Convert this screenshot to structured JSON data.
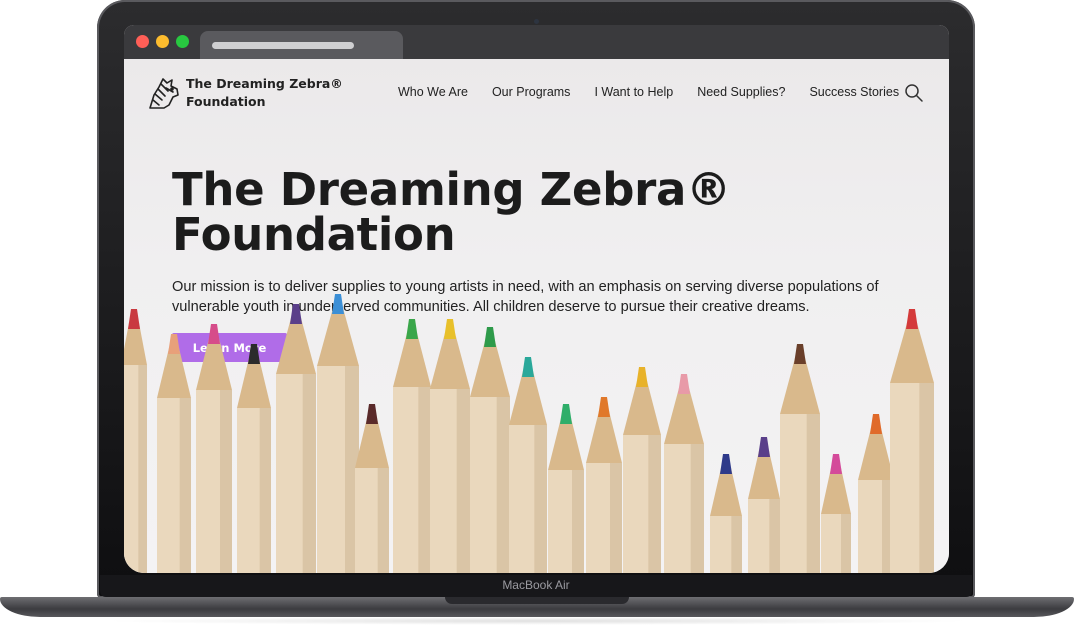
{
  "device": {
    "label": "MacBook Air"
  },
  "site": {
    "logo_text_line1": "The Dreaming Zebra®",
    "logo_text_line2": "Foundation",
    "nav": [
      {
        "label": "Who We Are"
      },
      {
        "label": "Our Programs"
      },
      {
        "label": "I Want to Help"
      },
      {
        "label": "Need Supplies?"
      },
      {
        "label": "Success Stories"
      }
    ],
    "search_icon": "search-icon"
  },
  "hero": {
    "title_line1": "The Dreaming Zebra®",
    "title_line2": "Foundation",
    "mission_line1": "Our mission is to deliver supplies to young artists in need, with an emphasis on serving diverse populations of",
    "mission_line2": "vulnerable youth in underserved communities.  All children deserve to pursue their creative dreams.",
    "cta_label": "Learn More",
    "cta_color": "#b06ce8"
  },
  "pencil_tip_colors": [
    "#c93a40",
    "#e8a07a",
    "#d64c8a",
    "#2b2b2b",
    "#5a3f8a",
    "#3b8fd6",
    "#5a2a2a",
    "#3aa64a",
    "#e8c02a",
    "#2e9a4a",
    "#2aa89a",
    "#2fae6a",
    "#e0782a",
    "#e8b22a",
    "#e89aa8",
    "#2e3a8a",
    "#5a3f8a",
    "#6a3f2a",
    "#d44a9a",
    "#e06a2a",
    "#d43a3a"
  ]
}
